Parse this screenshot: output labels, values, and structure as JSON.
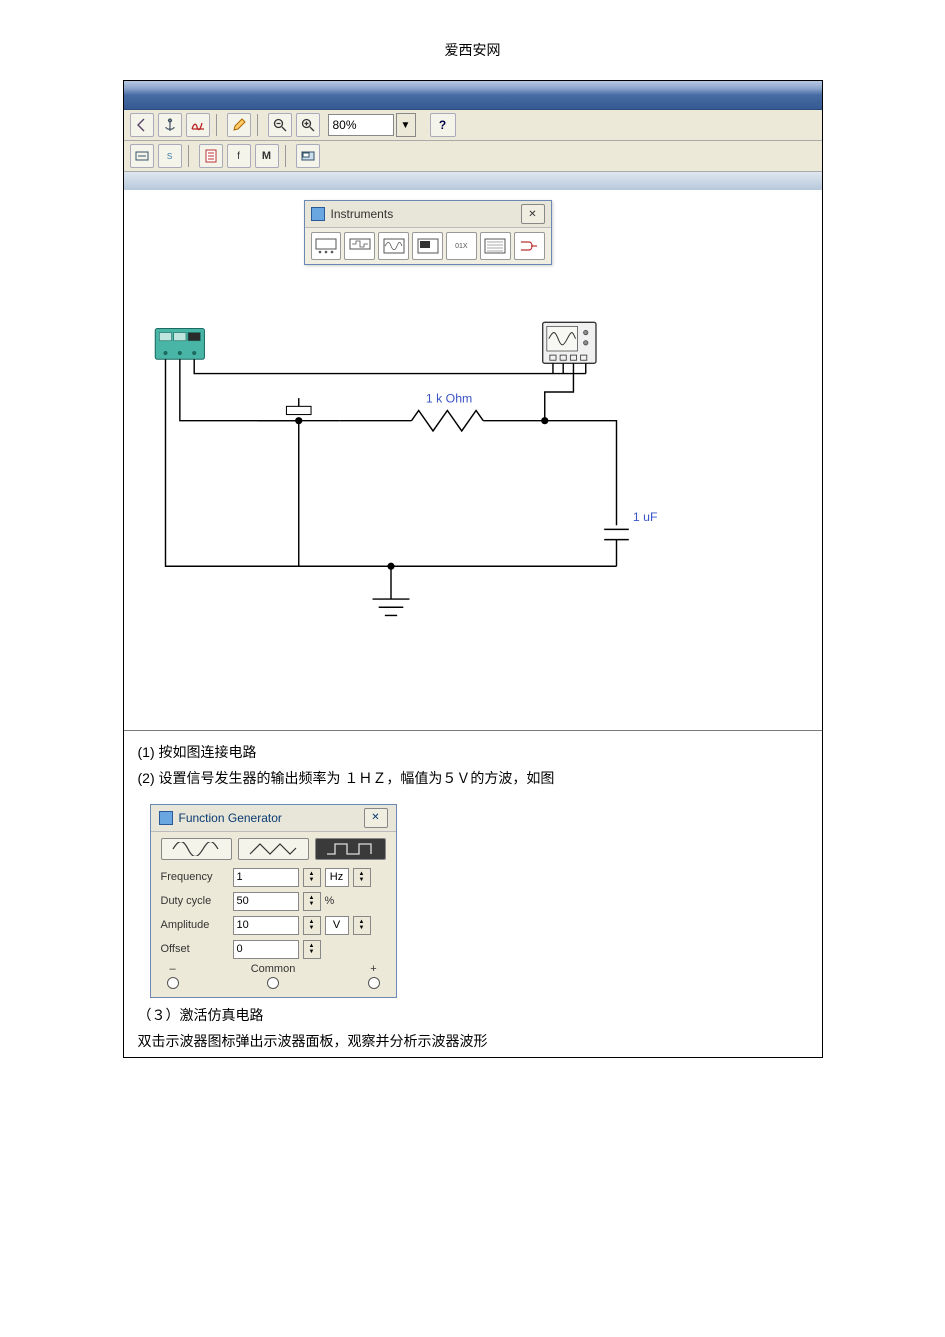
{
  "page_header": "爱西安网",
  "app": {
    "zoom_value": "80%",
    "help_label": "?",
    "toolbar1_icons": [
      "nav-back-icon",
      "anchor-icon",
      "graph-icon",
      "edit-icon",
      "zoom-out-icon",
      "zoom-in-icon"
    ],
    "toolbar2_icons": [
      "scroll-icon",
      "space-icon",
      "sheet-icon",
      "tabf-icon",
      "tabm-icon",
      "instrument-icon"
    ]
  },
  "instruments_palette": {
    "title": "Instruments",
    "close_glyph": "✕",
    "items": [
      "multimeter",
      "func-gen",
      "oscilloscope",
      "bode",
      "logic",
      "word-gen",
      "logic-conv"
    ]
  },
  "schematic": {
    "resistor_label": "1 k Ohm",
    "capacitor_label": "1 uF"
  },
  "text": {
    "step1": "(1)  按如图连接电路",
    "step2": "(2)  设置信号发生器的输出频率为 １ＨＺ，幅值为５Ｖ的方波，如图",
    "step3": "（３）激活仿真电路",
    "step4": "双击示波器图标弹出示波器面板，观察并分析示波器波形"
  },
  "func_gen": {
    "title": "Function Generator",
    "close_glyph": "✕",
    "rows": {
      "frequency": {
        "label": "Frequency",
        "value": "1",
        "unit": "Hz"
      },
      "duty": {
        "label": "Duty cycle",
        "value": "50",
        "unit": "%"
      },
      "amplitude": {
        "label": "Amplitude",
        "value": "10",
        "unit": "V"
      },
      "offset": {
        "label": "Offset",
        "value": "0",
        "unit": ""
      }
    },
    "terminals": {
      "minus": "–",
      "common": "Common",
      "plus": "+"
    }
  }
}
